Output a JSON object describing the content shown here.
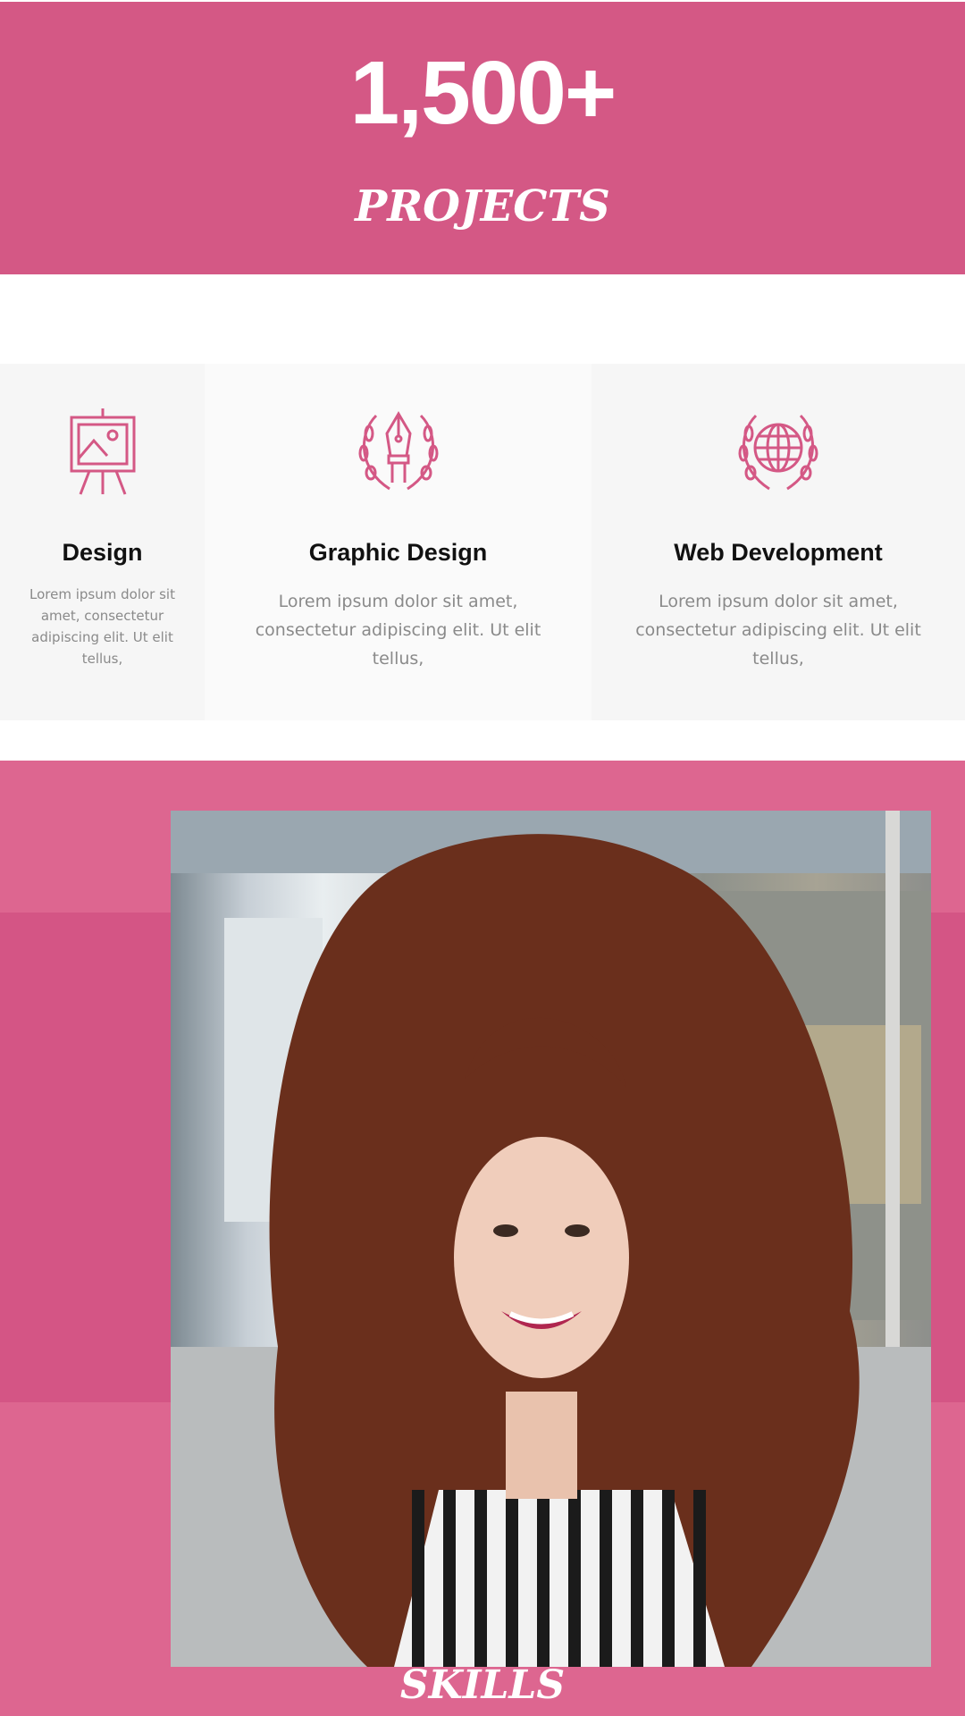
{
  "stat": {
    "value": "1,500+",
    "label": "PROJECTS"
  },
  "services": [
    {
      "icon": "easel-picture-icon",
      "title": "Design",
      "text": "Lorem ipsum dolor sit amet, consectetur adipiscing elit. Ut elit tellus,"
    },
    {
      "icon": "pen-nib-laurel-icon",
      "title": "Graphic Design",
      "text": "Lorem ipsum dolor sit amet, consectetur adipiscing elit. Ut elit tellus,"
    },
    {
      "icon": "globe-laurel-icon",
      "title": "Web Development",
      "text": "Lorem ipsum dolor sit amet, consectetur adipiscing elit. Ut elit tellus,"
    }
  ],
  "about": {
    "heading": "SKILLS"
  },
  "colors": {
    "accent": "#d45885",
    "accent_light": "#dd6690",
    "card_bg": "#f6f6f6"
  }
}
